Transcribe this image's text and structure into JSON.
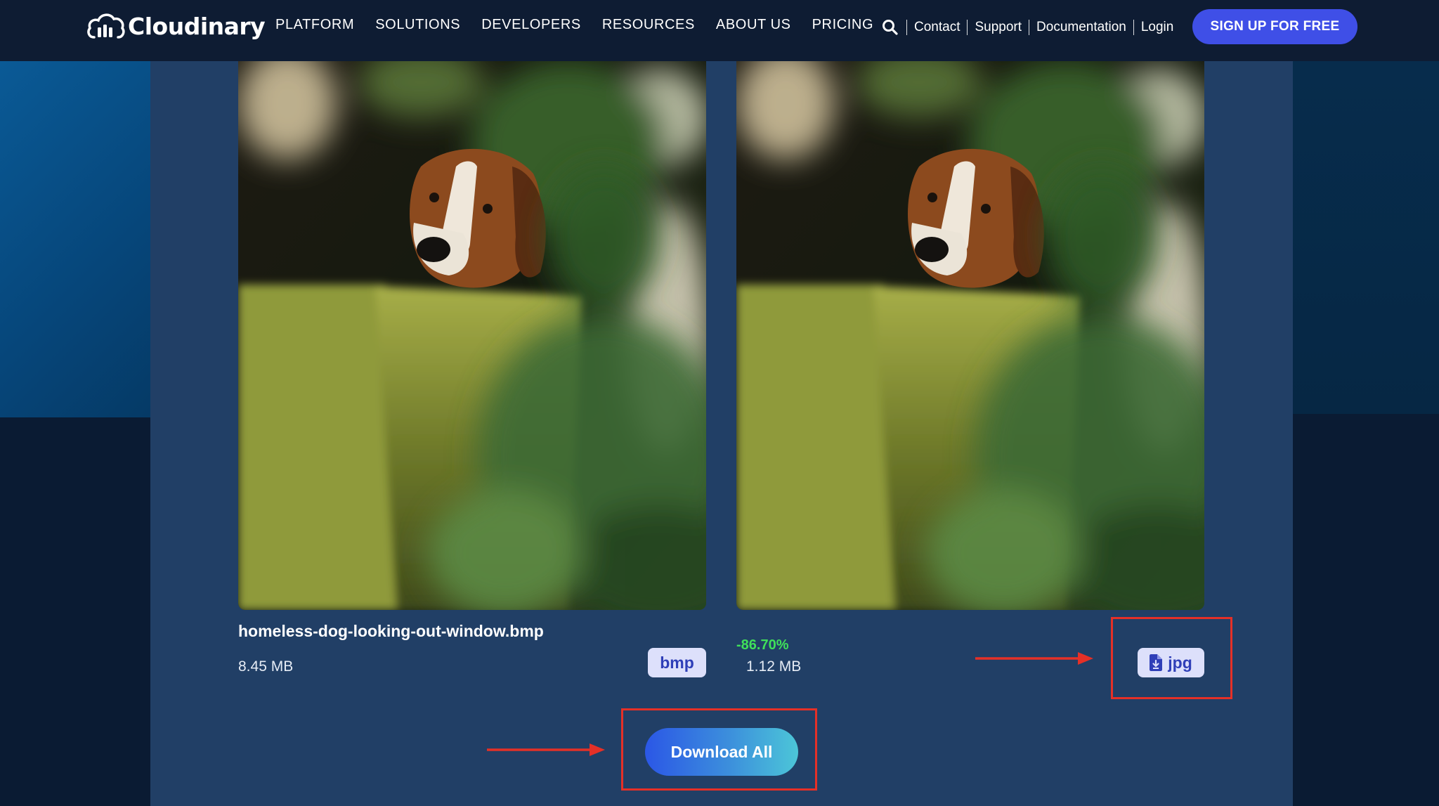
{
  "brand": {
    "name": "Cloudinary",
    "accent": "#3f4fe7",
    "nav_bg": "#0e1c33",
    "panel_bg": "#213f66",
    "success": "#3fe05a",
    "annotation": "#e53027"
  },
  "nav": {
    "menu": [
      "PLATFORM",
      "SOLUTIONS",
      "DEVELOPERS",
      "RESOURCES",
      "ABOUT US",
      "PRICING"
    ],
    "utils": [
      "Contact",
      "Support",
      "Documentation",
      "Login"
    ],
    "search_icon": "search-icon",
    "signup_label": "SIGN UP FOR FREE"
  },
  "result": {
    "original": {
      "filename": "homeless-dog-looking-out-window.bmp",
      "size": "8.45 MB",
      "format": "bmp"
    },
    "converted": {
      "reduction": "-86.70%",
      "size": "1.12 MB",
      "format": "jpg",
      "format_icon": "file-download-icon"
    },
    "download_all_label": "Download All"
  }
}
